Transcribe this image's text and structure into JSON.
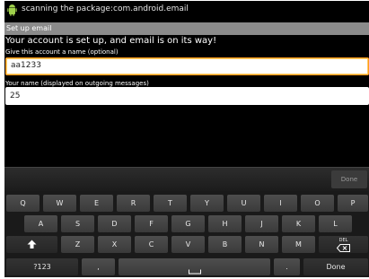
{
  "status_bar": {
    "text": "scanning the package:com.android.email",
    "icon": "android-icon"
  },
  "title_bar": {
    "title": "Set up email"
  },
  "form": {
    "headline": "Your account is set up, and email is on its way!",
    "account_name_label": "Give this account a name (optional)",
    "account_name_value": "aa1233",
    "your_name_label": "Your name (displayed on outgoing messages)",
    "your_name_value": "25"
  },
  "ime_bar": {
    "done_label": "Done"
  },
  "keyboard": {
    "row1": [
      "Q",
      "W",
      "E",
      "R",
      "T",
      "Y",
      "U",
      "I",
      "O",
      "P"
    ],
    "row2": [
      "A",
      "S",
      "D",
      "F",
      "G",
      "H",
      "J",
      "K",
      "L"
    ],
    "row3": [
      "Z",
      "X",
      "C",
      "V",
      "B",
      "N",
      "M"
    ],
    "shift_icon": "shift-arrow-icon",
    "del_label": "DEL",
    "del_icon": "backspace-icon",
    "symbols_label": "?123",
    "comma": ",",
    "space_icon": "space-bar-icon",
    "period": ".",
    "done_label": "Done"
  }
}
